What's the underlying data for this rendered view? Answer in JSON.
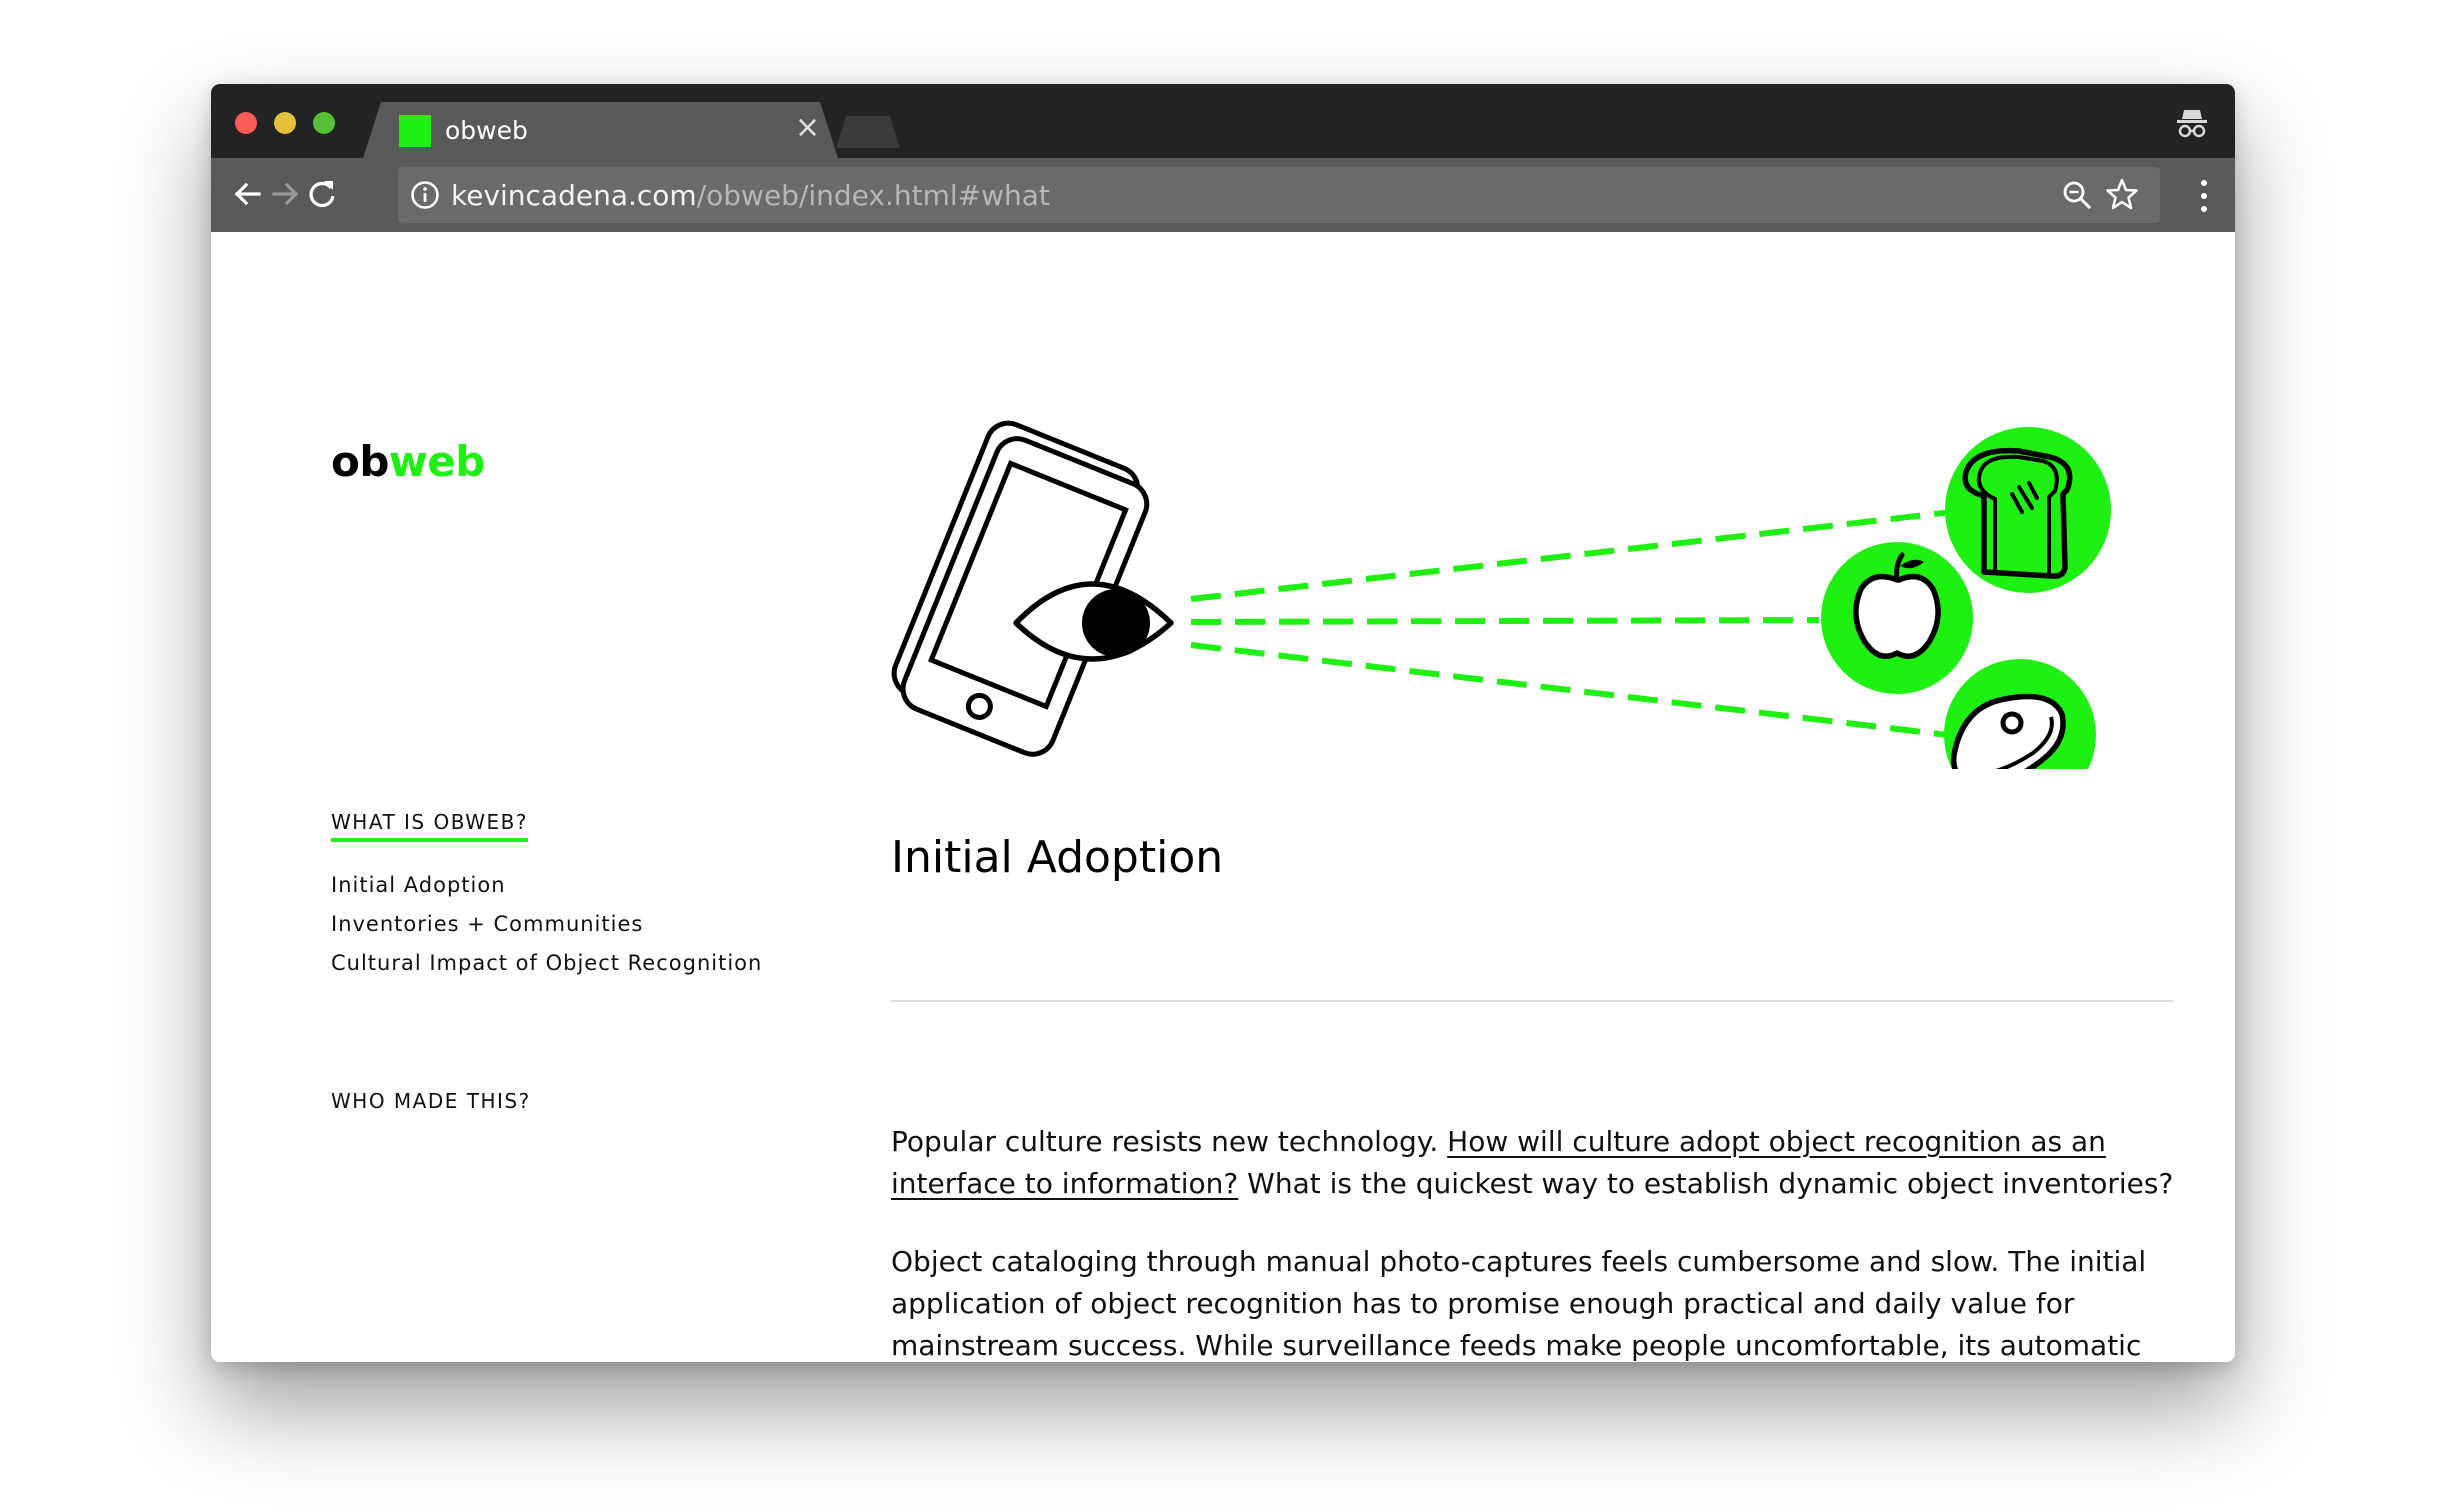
{
  "browser": {
    "tab": {
      "title": "obweb",
      "close_glyph": "×"
    },
    "address": {
      "host": "kevincadena.com",
      "path": "/obweb/index.html#what"
    },
    "icons": [
      "back-icon",
      "forward-icon",
      "reload-icon",
      "info-icon",
      "zoom-icon",
      "star-icon",
      "menu-icon",
      "incognito-icon"
    ]
  },
  "site": {
    "logo": {
      "ob": "ob",
      "web": "web"
    },
    "nav": {
      "section": "WHAT IS OBWEB?",
      "items": [
        "Initial Adoption",
        "Inventories + Communities",
        "Cultural Impact of Object Recognition"
      ],
      "about": "WHO MADE THIS?"
    },
    "accent": "#1ef011",
    "illustration_icons": [
      "phone-icon",
      "eye-icon",
      "bread-icon",
      "apple-icon",
      "steak-icon"
    ]
  },
  "content": {
    "heading": "Initial Adoption",
    "p1": {
      "before": "Popular culture resists new technology. ",
      "link": "How will culture adopt object recognition as an interface to information?",
      "after": " What is the quickest way to establish dynamic object inventories?"
    },
    "p2": "Object cataloging through manual photo-captures feels cumbersome and slow. The initial application of object recognition has to promise enough practical and daily value for mainstream success. While surveillance feeds make people uncomfortable, its automatic nature makes it the easiest implementation."
  }
}
